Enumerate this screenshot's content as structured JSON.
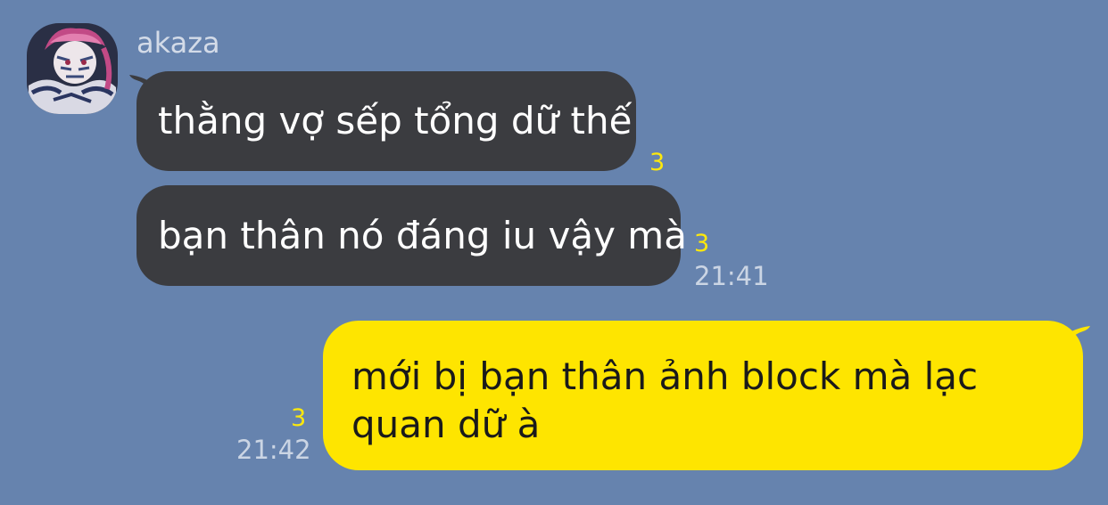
{
  "chat": {
    "sender": {
      "name": "akaza",
      "avatar_icon": "avatar-image"
    },
    "incoming": [
      {
        "text": "thằng vợ sếp tổng dữ thế",
        "unread_count": "3"
      },
      {
        "text": "bạn thân nó đáng iu vậy mà",
        "unread_count": "3",
        "time": "21:41"
      }
    ],
    "outgoing": [
      {
        "text": "mới bị bạn thân ảnh block mà lạc quan dữ à",
        "unread_count": "3",
        "time": "21:42"
      }
    ]
  },
  "colors": {
    "background": "#6683ae",
    "incoming_bubble": "#3b3c40",
    "outgoing_bubble": "#fee500",
    "unread_count": "#fde80c",
    "timestamp": "#cbd5e4"
  }
}
